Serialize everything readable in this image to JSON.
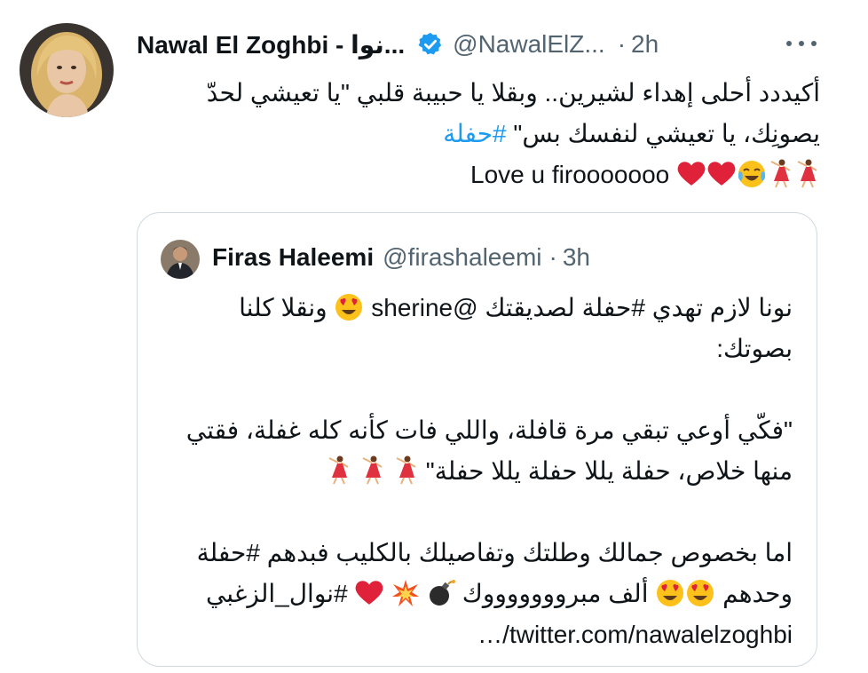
{
  "tweet": {
    "display_name": "Nawal El Zoghbi - نوا...",
    "handle": "@NawalElZ...",
    "separator": "·",
    "time": "2h",
    "verified": true,
    "text_lines": [
      "أكيددد أحلى إهداء لشيرين.. وبقلا يا حبيبة قلبي \"يا تعيشي لحدّ",
      "يصونِك، يا تعيشي لنفسك بس\"",
      "Love u firooooooo"
    ],
    "hashtag": "#حفلة",
    "emojis": [
      "red-heart",
      "red-heart",
      "face-with-tears-of-joy",
      "woman-dancing",
      "woman-dancing"
    ]
  },
  "quote": {
    "display_name": "Firas Haleemi",
    "handle": "@firashaleemi",
    "separator": "·",
    "time": "3h",
    "paragraph1_line1_a": "نونا لازم تهدي #حفلة لصديقتك",
    "paragraph1_mention": "@sherine",
    "paragraph1_line1_b": "ونقلا كلنا",
    "paragraph1_line2": "بصوتك:",
    "paragraph2_line1": "\"فكّي أوعي تبقي مرة قافلة، واللي فات كأنه كله غفلة، فقتي",
    "paragraph2_line2": "منها خلاص، حفلة يللا حفلة يللا حفلة\"",
    "paragraph3_line1": "اما بخصوص جمالك وطلتك وتفاصيلك بالكليب فبدهم #حفلة",
    "paragraph3_line2_a": "وحدهم",
    "paragraph3_line2_b": "ألف مبروووووووك",
    "paragraph3_line2_c": "#نوال_الزغبي",
    "paragraph3_line3": "…/twitter.com/nawalelzoghbi"
  },
  "colors": {
    "text": "#0f1419",
    "secondary": "#536471",
    "link": "#1d9bf0",
    "border": "#cfd9de"
  }
}
